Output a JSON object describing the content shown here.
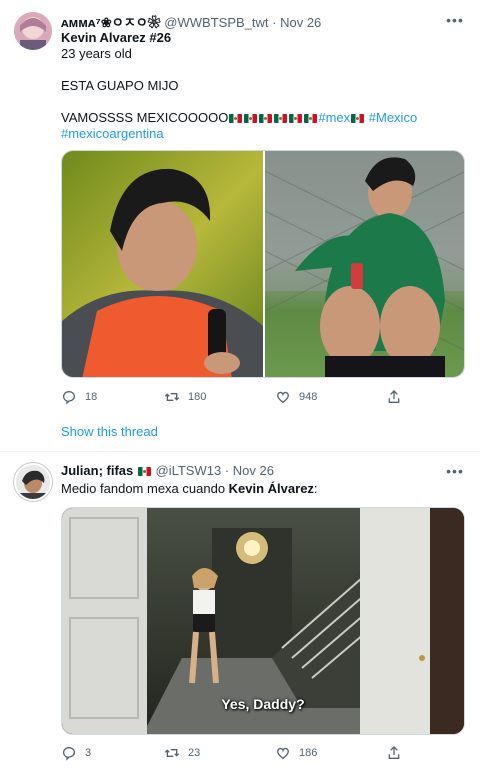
{
  "tweets": [
    {
      "author_name": "ᴀᴍᴍᴀ⁷❀ㅇㅈㅇ❀",
      "handle": "@WWBTSPB_twt",
      "separator": "·",
      "date": "Nov 26",
      "lines": [
        "Kevin Alvarez #26",
        "23 years old",
        "ESTA GUAPO MIJO",
        "VAMOSSSS MEXICOOOOO"
      ],
      "hashtags": [
        "#mex",
        "#Mexico",
        "#mexicoargentina"
      ],
      "actions": {
        "replies": "18",
        "retweets": "180",
        "likes": "948"
      },
      "show_thread": "Show this thread"
    },
    {
      "author_name": "Julian; fifas",
      "handle": "@iLTSW13",
      "separator": "·",
      "date": "Nov 26",
      "text_prefix": "Medio fandom mexa cuando ",
      "text_bold": "Kevin Álvarez",
      "text_suffix": ":",
      "media_subtitle": "Yes, Daddy?",
      "actions": {
        "replies": "3",
        "retweets": "23",
        "likes": "186"
      }
    }
  ],
  "icons": {
    "more": "more-icon",
    "reply": "reply-icon",
    "retweet": "retweet-icon",
    "like": "like-icon",
    "share": "share-icon"
  },
  "colors": {
    "link": "#1d9bf0",
    "muted": "#536471",
    "text": "#0f1419"
  }
}
